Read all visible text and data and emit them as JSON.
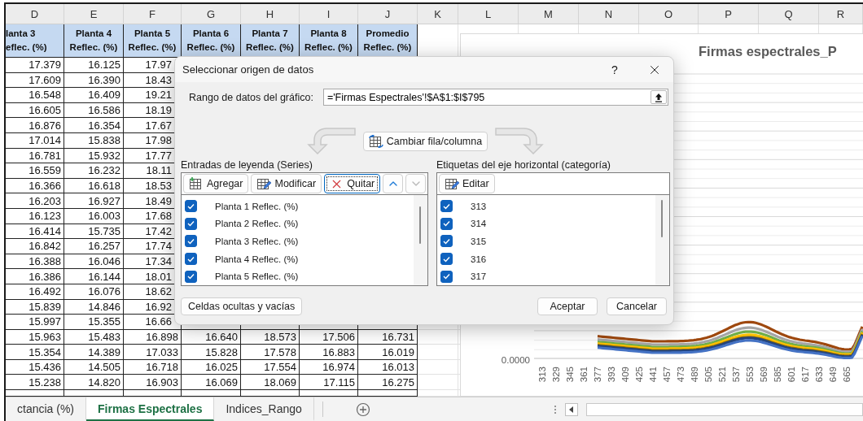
{
  "column_letters": [
    "D",
    "E",
    "F",
    "G",
    "H",
    "I",
    "J",
    "K",
    "L",
    "M",
    "N",
    "O",
    "P",
    "Q",
    "R"
  ],
  "table": {
    "headers": [
      {
        "name": "lanta 3",
        "unit": "eflec. (%)"
      },
      {
        "name": "Planta 4",
        "unit": "Reflec. (%)"
      },
      {
        "name": "Planta 5",
        "unit": "Reflec. (%)"
      },
      {
        "name": "Planta 6",
        "unit": "Reflec. (%)"
      },
      {
        "name": "Planta 7",
        "unit": "Reflec. (%)"
      },
      {
        "name": "Planta 8",
        "unit": "Reflec. (%)"
      },
      {
        "name": "Promedio",
        "unit": "Reflec. (%)"
      }
    ],
    "rows": [
      [
        "17.379",
        "16.125",
        "17.97"
      ],
      [
        "17.609",
        "16.390",
        "18.43"
      ],
      [
        "16.548",
        "16.409",
        "19.21"
      ],
      [
        "16.605",
        "16.586",
        "18.19"
      ],
      [
        "16.876",
        "16.354",
        "17.67"
      ],
      [
        "17.014",
        "15.838",
        "17.98"
      ],
      [
        "16.781",
        "15.932",
        "17.77"
      ],
      [
        "16.559",
        "16.232",
        "18.11"
      ],
      [
        "16.366",
        "16.618",
        "18.53"
      ],
      [
        "16.203",
        "16.927",
        "18.49"
      ],
      [
        "16.123",
        "16.003",
        "17.68"
      ],
      [
        "16.414",
        "15.735",
        "17.42"
      ],
      [
        "16.842",
        "16.257",
        "17.74"
      ],
      [
        "16.388",
        "16.046",
        "17.34"
      ],
      [
        "16.386",
        "16.144",
        "18.01"
      ],
      [
        "16.492",
        "16.076",
        "18.62"
      ],
      [
        "15.839",
        "14.846",
        "16.92"
      ],
      [
        "15.997",
        "15.355",
        "16.66"
      ],
      [
        "15.963",
        "15.483",
        "16.898",
        "16.640",
        "18.573",
        "17.506",
        "16.731"
      ],
      [
        "15.354",
        "14.389",
        "17.033",
        "15.828",
        "17.578",
        "16.883",
        "16.019"
      ],
      [
        "15.436",
        "14.505",
        "16.718",
        "16.025",
        "17.554",
        "16.974",
        "16.013"
      ],
      [
        "15.238",
        "14.820",
        "16.903",
        "16.069",
        "18.069",
        "17.115",
        "16.275"
      ]
    ]
  },
  "chart": {
    "title": "Firmas espectrales_P",
    "y_label": "0.0000",
    "x_labels": [
      "313",
      "329",
      "345",
      "361",
      "377",
      "393",
      "409",
      "425",
      "441",
      "457",
      "473",
      "489",
      "505",
      "521",
      "537",
      "553",
      "569",
      "585",
      "601",
      "617",
      "633",
      "649",
      "665"
    ]
  },
  "dialog": {
    "title": "Seleccionar origen de datos",
    "help": "?",
    "range_label": "Rango de datos del gráfico:",
    "range_value": "='Firmas Espectrales'!$A$1:$I$795",
    "switch_button": "Cambiar fila/columna",
    "series_panel": {
      "title": "Entradas de leyenda (Series)",
      "buttons": [
        {
          "label": "Agregar",
          "kind": "add",
          "focused": false
        },
        {
          "label": "Modificar",
          "kind": "edit",
          "focused": false
        },
        {
          "label": "Quitar",
          "kind": "remove",
          "focused": true
        }
      ],
      "move_up": {
        "disabled": false
      },
      "move_down": {
        "disabled": true
      },
      "items": [
        {
          "label": "Planta 1 Reflec. (%)",
          "checked": true
        },
        {
          "label": "Planta 2 Reflec. (%)",
          "checked": true
        },
        {
          "label": "Planta 3 Reflec. (%)",
          "checked": true
        },
        {
          "label": "Planta 4 Reflec. (%)",
          "checked": true
        },
        {
          "label": "Planta 5 Reflec. (%)",
          "checked": true
        }
      ]
    },
    "category_panel": {
      "title": "Etiquetas del eje horizontal (categoría)",
      "buttons": [
        {
          "label": "Editar",
          "kind": "edit",
          "focused": false
        }
      ],
      "items": [
        {
          "label": "313",
          "checked": true
        },
        {
          "label": "314",
          "checked": true
        },
        {
          "label": "315",
          "checked": true
        },
        {
          "label": "316",
          "checked": true
        },
        {
          "label": "317",
          "checked": true
        }
      ]
    },
    "hidden_cells_button": "Celdas ocultas y vacías",
    "ok_button": "Aceptar",
    "cancel_button": "Cancelar"
  },
  "sheet_tabs": [
    {
      "label": "ctancia (%)",
      "selected": false
    },
    {
      "label": "Firmas Espectrales",
      "selected": true
    },
    {
      "label": "Indices_Rango",
      "selected": false
    }
  ]
}
